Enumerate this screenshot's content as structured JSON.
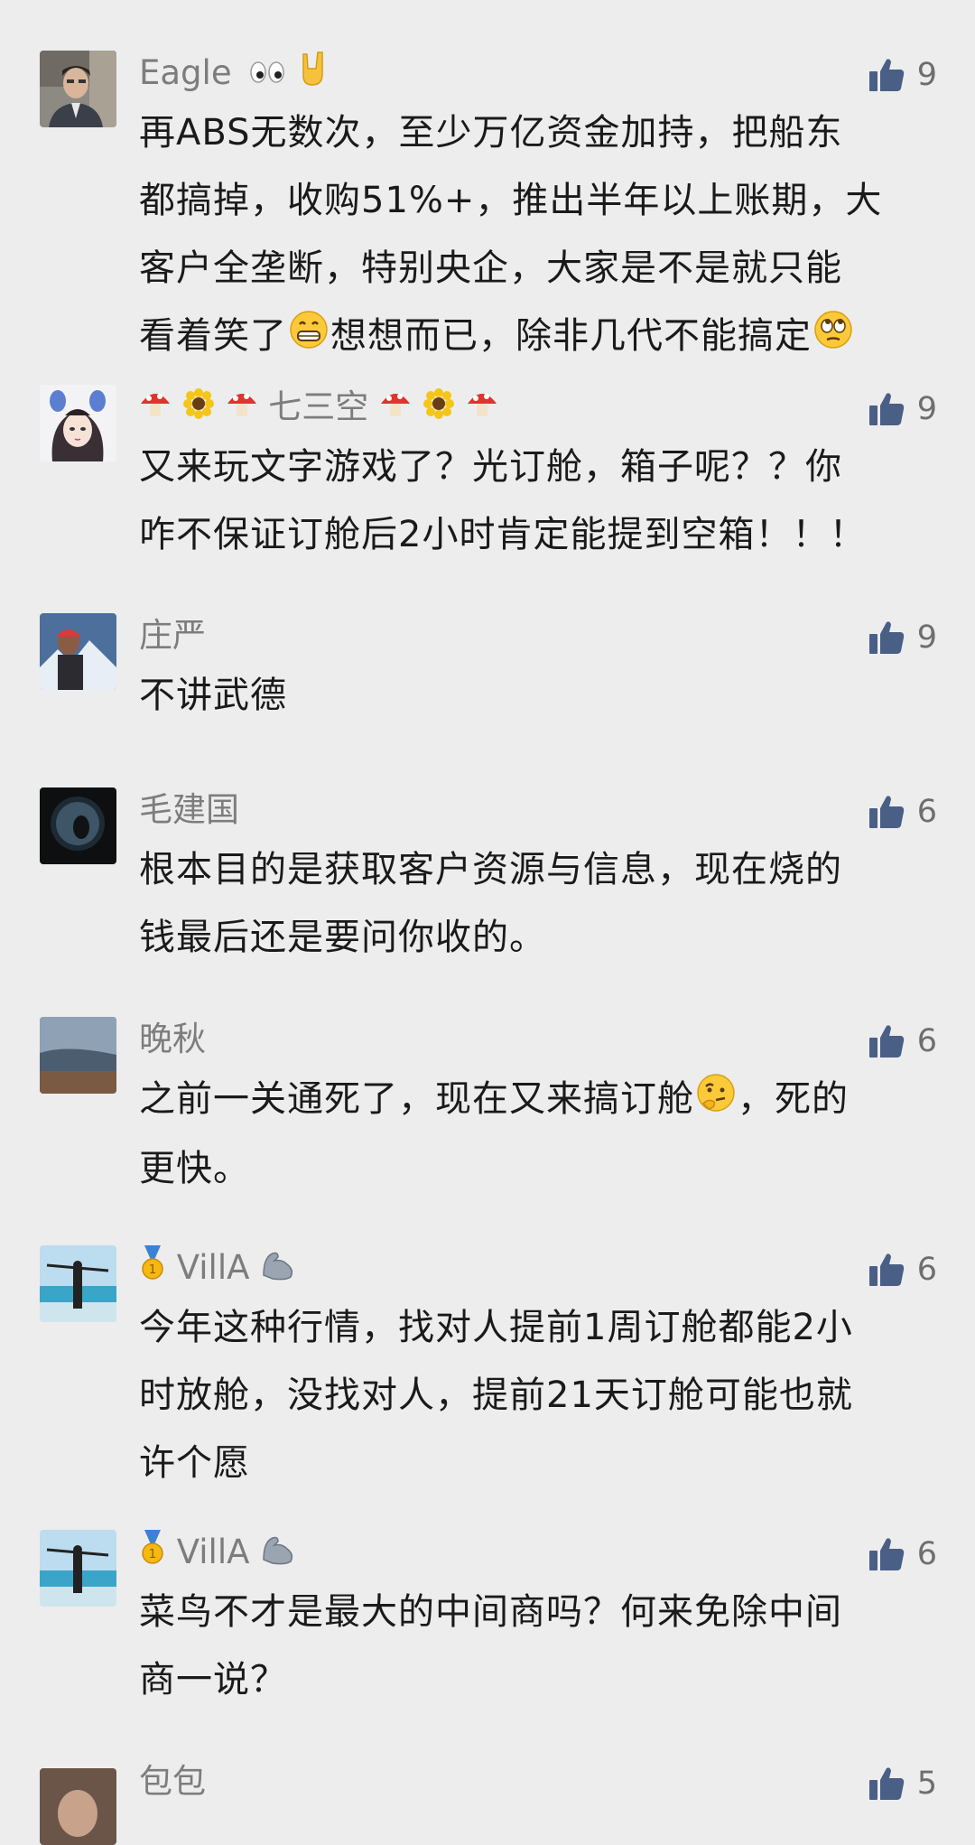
{
  "comments": [
    {
      "name": "Eagle",
      "likes": "9",
      "lines": [
        "再ABS无数次，至少万亿资金加持，把船东",
        "都搞掉，收购51%+，推出半年以上账期，大",
        "客户全垄断，特别央企，大家是不是就只能",
        "看着笑了",
        "想想而已，除非几代不能搞定"
      ]
    },
    {
      "name": "七三空",
      "likes": "9",
      "lines": [
        "又来玩文字游戏了？光订舱，箱子呢？？你",
        "咋不保证订舱后2小时肯定能提到空箱！！！"
      ]
    },
    {
      "name": "庄严",
      "likes": "9",
      "lines": [
        "不讲武德"
      ]
    },
    {
      "name": "毛建国",
      "likes": "6",
      "lines": [
        "根本目的是获取客户资源与信息，现在烧的",
        "钱最后还是要问你收的。"
      ]
    },
    {
      "name": "晚秋",
      "likes": "6",
      "lines": [
        "之前一关通死了，现在又来搞订舱",
        "，死的",
        "更快。"
      ]
    },
    {
      "name": "VillA",
      "likes": "6",
      "lines": [
        "今年这种行情，找对人提前1周订舱都能2小",
        "时放舱，没找对人，提前21天订舱可能也就",
        "许个愿"
      ]
    },
    {
      "name": "VillA",
      "likes": "6",
      "lines": [
        "菜鸟不才是最大的中间商吗？何来免除中间",
        "商一说？"
      ]
    },
    {
      "name": "包包",
      "likes": "5",
      "lines": []
    }
  ],
  "icons": {
    "like": "thumbs-up-icon",
    "like_color": "#4a5f86"
  }
}
